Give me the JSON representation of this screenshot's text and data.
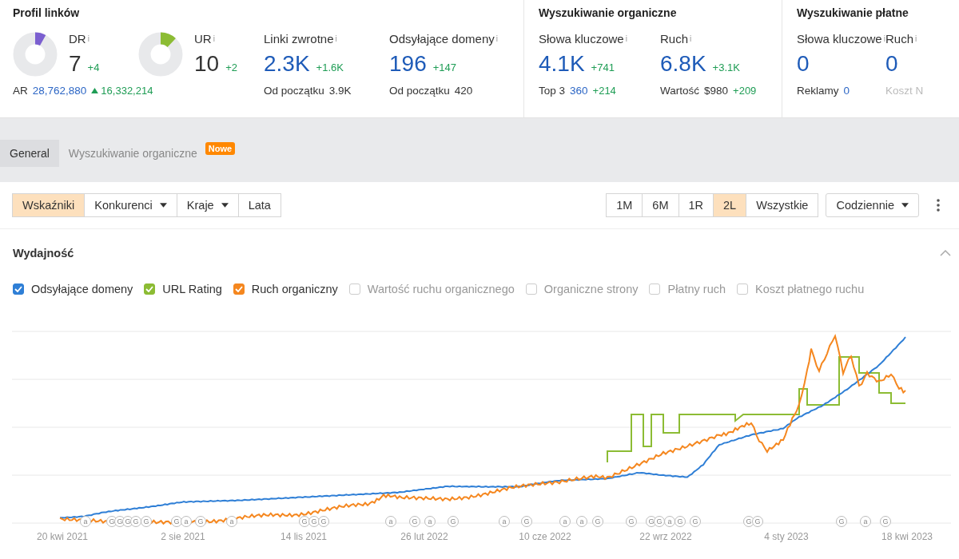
{
  "link_profile": {
    "title": "Profil linków",
    "metrics": [
      {
        "kind": "ring",
        "label": "DR",
        "info": "i",
        "value": "7",
        "delta": "+4",
        "level": 0.08,
        "color": "#7b5fd0",
        "sub_label": "AR",
        "sub_value": "28,762,880",
        "sub_value_link": true,
        "sub_delta": "16,332,214",
        "trend_up": true
      },
      {
        "kind": "ring",
        "label": "UR",
        "info": "i",
        "value": "10",
        "delta": "+2",
        "level": 0.12,
        "color": "#8cbc34"
      },
      {
        "kind": "stat",
        "label": "Linki zwrotne",
        "info": "i",
        "value": "2.3K",
        "delta": "+1.6K",
        "sub_label": "Od początku",
        "sub_value": "3.9K",
        "sub_value_link": false
      },
      {
        "kind": "stat",
        "label": "Odsyłające domeny",
        "info": "i",
        "value": "196",
        "delta": "+147",
        "sub_label": "Od początku",
        "sub_value": "420",
        "sub_value_link": false
      }
    ]
  },
  "organic": {
    "title": "Wyszukiwanie organiczne",
    "metrics": [
      {
        "kind": "stat",
        "label": "Słowa kluczowe",
        "info": "i",
        "value": "4.1K",
        "delta": "+741",
        "sub_label": "Top 3",
        "sub_value": "360",
        "sub_value_link": true,
        "sub_delta": "+214"
      },
      {
        "kind": "stat",
        "label": "Ruch",
        "info": "i",
        "value": "6.8K",
        "delta": "+3.1K",
        "sub_label": "Wartość",
        "sub_value": "$980",
        "sub_value_link": false,
        "sub_delta": "+209"
      }
    ]
  },
  "paid": {
    "title": "Wyszukiwanie płatne",
    "metrics": [
      {
        "kind": "stat",
        "label": "Słowa kluczowe",
        "info": "i",
        "value": "0",
        "sub_label": "Reklamy",
        "sub_value": "0",
        "sub_value_link": true,
        "disabled": false
      },
      {
        "kind": "stat",
        "label": "Ruch",
        "info": "i",
        "value": "0",
        "sub_label": "Koszt N",
        "disabled": true
      }
    ]
  },
  "tabs": [
    {
      "label": "General",
      "selected": true
    },
    {
      "label": "Wyszukiwanie organiczne",
      "selected": false,
      "badge": "Nowe"
    }
  ],
  "view_buttons": [
    {
      "label": "Wskaźniki",
      "selected": true,
      "dropdown": false
    },
    {
      "label": "Konkurenci",
      "selected": false,
      "dropdown": true
    },
    {
      "label": "Kraje",
      "selected": false,
      "dropdown": true
    },
    {
      "label": "Lata",
      "selected": false,
      "dropdown": false
    }
  ],
  "periods": [
    {
      "label": "1M",
      "selected": false
    },
    {
      "label": "6M",
      "selected": false
    },
    {
      "label": "1R",
      "selected": false
    },
    {
      "label": "2L",
      "selected": true
    },
    {
      "label": "Wszystkie",
      "selected": false
    }
  ],
  "interval": {
    "label": "Codziennie"
  },
  "panel": {
    "title": "Wydajność",
    "expanded": true,
    "series": [
      {
        "label": "Odsyłające domeny",
        "checked": true,
        "color": "#2f7fd6"
      },
      {
        "label": "URL Rating",
        "checked": true,
        "color": "#8cbc34"
      },
      {
        "label": "Ruch organiczny",
        "checked": true,
        "color": "#f5871f"
      },
      {
        "label": "Wartość ruchu organicznego",
        "checked": false
      },
      {
        "label": "Organiczne strony",
        "checked": false
      },
      {
        "label": "Płatny ruch",
        "checked": false
      },
      {
        "label": "Koszt płatnego ruchu",
        "checked": false
      }
    ],
    "x_labels": [
      "20 kwi 2021",
      "2 sie 2021",
      "14 lis 2021",
      "26 lut 2022",
      "10 cze 2022",
      "22 wrz 2022",
      "4 sty 2023",
      "18 kwi 2023"
    ],
    "markers": [
      "a",
      "G",
      "G",
      "G",
      "G",
      "G",
      "G",
      "a",
      "G",
      "a",
      "G",
      "G",
      "G",
      "a",
      "G",
      "a",
      "G",
      "a",
      "G",
      "a",
      "a",
      "G",
      "G",
      "G",
      "G",
      "a",
      "G",
      "G",
      "G",
      "G",
      "G",
      "a",
      "G"
    ]
  }
}
